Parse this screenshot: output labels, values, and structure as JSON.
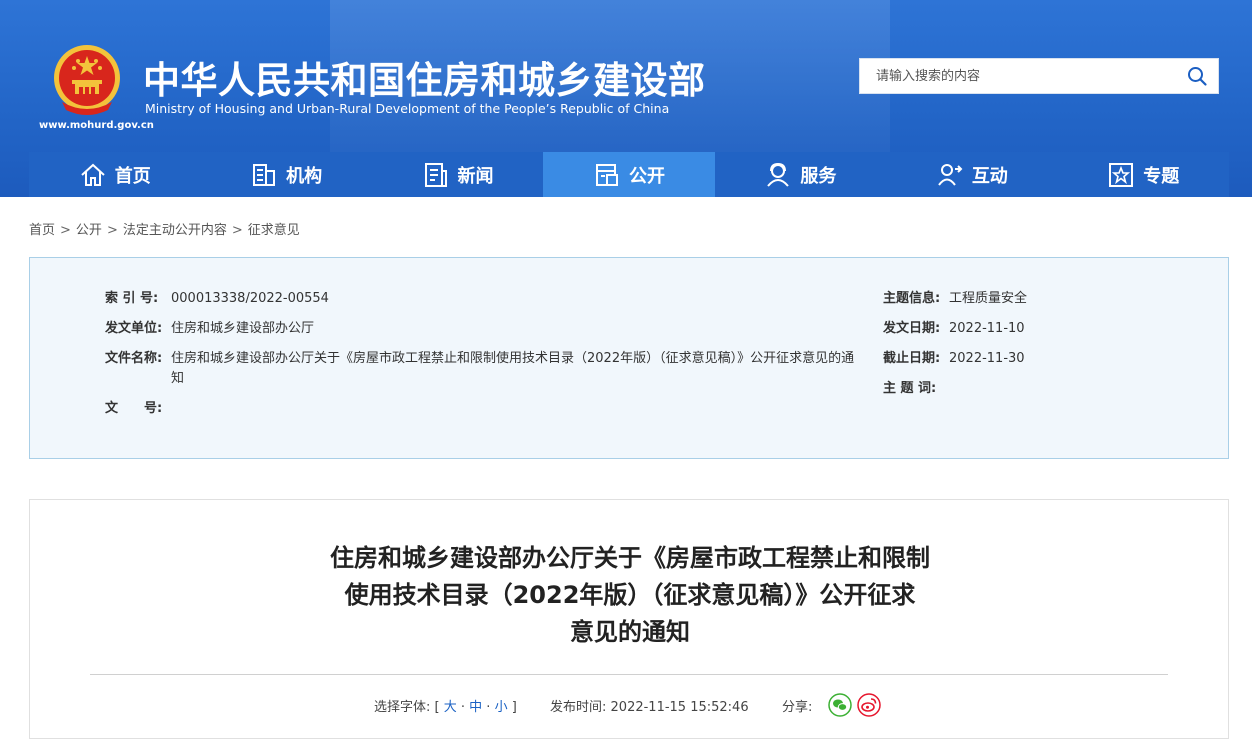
{
  "header": {
    "title_cn": "中华人民共和国住房和城乡建设部",
    "title_en": "Ministry of Housing and Urban-Rural Development of the People’s Republic of China",
    "site_url": "www.mohurd.gov.cn",
    "search_placeholder": "请输入搜索的内容",
    "brand_blue": "#2366c8"
  },
  "nav": {
    "items": [
      {
        "label": "首页",
        "icon": "home-icon"
      },
      {
        "label": "机构",
        "icon": "building-icon"
      },
      {
        "label": "新闻",
        "icon": "news-icon"
      },
      {
        "label": "公开",
        "icon": "open-doc-icon",
        "active": true
      },
      {
        "label": "服务",
        "icon": "service-icon"
      },
      {
        "label": "互动",
        "icon": "interaction-icon"
      },
      {
        "label": "专题",
        "icon": "topic-star-icon"
      }
    ],
    "active_color": "#3a8be4"
  },
  "breadcrumb": {
    "items": [
      "首页",
      "公开",
      "法定主动公开内容",
      "征求意见"
    ],
    "separator": ">"
  },
  "info": {
    "index_label": "索 引 号:",
    "index_value": "000013338/2022-00554",
    "unit_label": "发文单位:",
    "unit_value": "住房和城乡建设部办公厅",
    "name_label": "文件名称:",
    "name_value": "住房和城乡建设部办公厅关于《房屋市政工程禁止和限制使用技术目录（2022年版）（征求意见稿）》公开征求意见的通知",
    "docno_label": "文　　号:",
    "docno_value": "",
    "topic_label": "主题信息:",
    "topic_value": "工程质量安全",
    "date_label": "发文日期:",
    "date_value": "2022-11-10",
    "deadline_label": "截止日期:",
    "deadline_value": "2022-11-30",
    "keywords_label": "主 题 词:",
    "keywords_value": ""
  },
  "article": {
    "title_line1": "住房和城乡建设部办公厅关于《房屋市政工程禁止和限制",
    "title_line2": "使用技术目录（2022年版）（征求意见稿）》公开征求",
    "title_line3": "意见的通知",
    "font_select_label": "选择字体:",
    "font_large": "大",
    "font_medium": "中",
    "font_small": "小",
    "publish_label": "发布时间:",
    "publish_time": "2022-11-15 15:52:46",
    "share_label": "分享:",
    "wechat_color": "#3cb034",
    "weibo_color": "#e6162d"
  }
}
